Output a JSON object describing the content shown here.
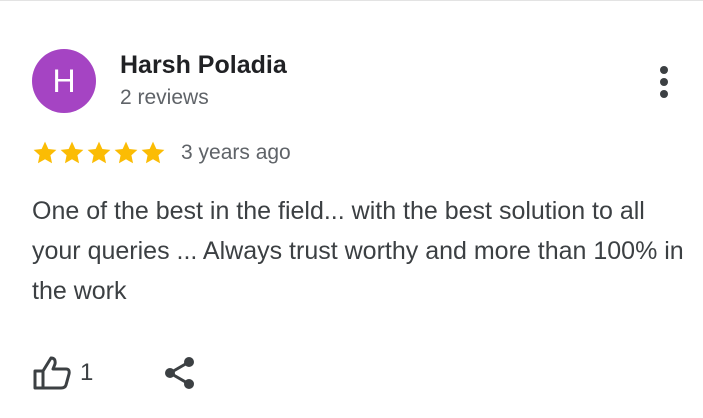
{
  "reviewer": {
    "initial": "H",
    "avatar_color": "#a544c3",
    "name": "Harsh Poladia",
    "reviews_count": "2 reviews"
  },
  "review": {
    "rating": 5,
    "max_rating": 5,
    "star_color": "#fbbc04",
    "date": "3 years ago",
    "text": "One of the best in the field... with the best solution to all your queries ... Always trust worthy and more than 100% in the work"
  },
  "actions": {
    "like_icon": "thumbs-up-icon",
    "like_count": "1",
    "share_icon": "share-icon",
    "more_icon": "more-vertical-icon"
  },
  "colors": {
    "primary_text": "#202124",
    "secondary_text": "#5f6368",
    "body_text": "#3c4043",
    "icon": "#3c4043"
  }
}
